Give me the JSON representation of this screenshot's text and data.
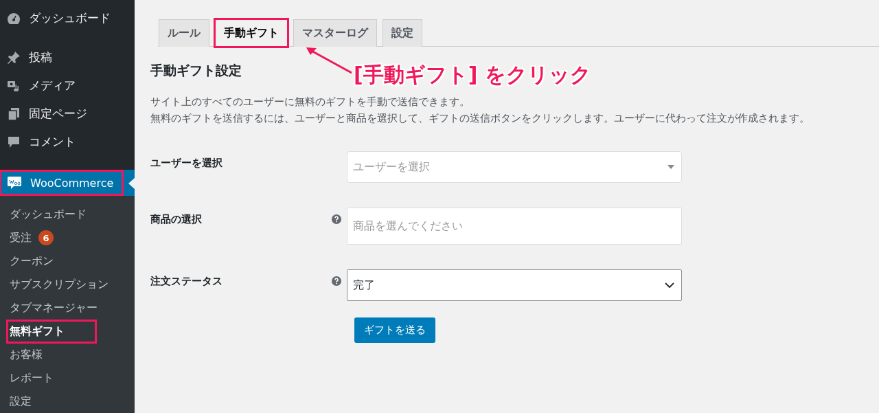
{
  "sidebar": {
    "menu": [
      {
        "label": "ダッシュボード"
      },
      {
        "label": "投稿"
      },
      {
        "label": "メディア"
      },
      {
        "label": "固定ページ"
      },
      {
        "label": "コメント"
      }
    ],
    "active_menu": {
      "label": "WooCommerce",
      "highlighted": true
    },
    "submenu": [
      {
        "label": "ダッシュボード",
        "selected": false,
        "highlighted": false
      },
      {
        "label": "受注",
        "badge": "6",
        "selected": false,
        "highlighted": false
      },
      {
        "label": "クーポン",
        "selected": false,
        "highlighted": false
      },
      {
        "label": "サブスクリプション",
        "selected": false,
        "highlighted": false
      },
      {
        "label": "タブマネージャー",
        "selected": false,
        "highlighted": false
      },
      {
        "label": "無料ギフト",
        "selected": true,
        "highlighted": true
      },
      {
        "label": "お客様",
        "selected": false,
        "highlighted": false
      },
      {
        "label": "レポート",
        "selected": false,
        "highlighted": false
      },
      {
        "label": "設定",
        "selected": false,
        "highlighted": false
      }
    ]
  },
  "tabs": [
    {
      "label": "ルール",
      "selected": false,
      "highlighted": false
    },
    {
      "label": "手動ギフト",
      "selected": true,
      "highlighted": true
    },
    {
      "label": "マスターログ",
      "selected": false,
      "highlighted": false
    },
    {
      "label": "設定",
      "selected": false,
      "highlighted": false
    }
  ],
  "callout": {
    "text": "[手動ギフト] をクリック"
  },
  "section": {
    "title": "手動ギフト設定",
    "description": [
      "サイト上のすべてのユーザーに無料のギフトを手動で送信できます。",
      "無料のギフトを送信するには、ユーザーと商品を選択して、ギフトの送信ボタンをクリックします。ユーザーに代わって注文が作成されます。"
    ]
  },
  "form": [
    {
      "kind": "combo",
      "label": "ユーザーを選択",
      "help": false,
      "placeholder": "ユーザーを選択"
    },
    {
      "kind": "text",
      "label": "商品の選択",
      "help": true,
      "placeholder": "商品を選んでください"
    },
    {
      "kind": "select",
      "label": "注文ステータス",
      "help": true,
      "value": "完了"
    }
  ],
  "submit": {
    "label": "ギフトを送る"
  }
}
